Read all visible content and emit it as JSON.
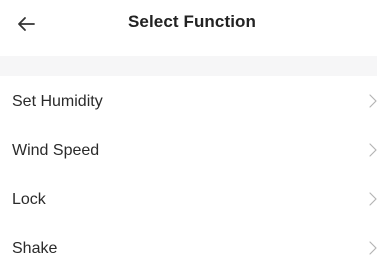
{
  "header": {
    "title": "Select Function",
    "back_icon": "arrow-left-icon"
  },
  "functions": [
    {
      "label": "Set Humidity",
      "icon": "chevron-right-icon"
    },
    {
      "label": "Wind Speed",
      "icon": "chevron-right-icon"
    },
    {
      "label": "Lock",
      "icon": "chevron-right-icon"
    },
    {
      "label": "Shake",
      "icon": "chevron-right-icon"
    }
  ],
  "colors": {
    "background": "#ffffff",
    "section_band": "#f6f6f7",
    "text": "#222222",
    "chevron": "#b5b5b5"
  }
}
